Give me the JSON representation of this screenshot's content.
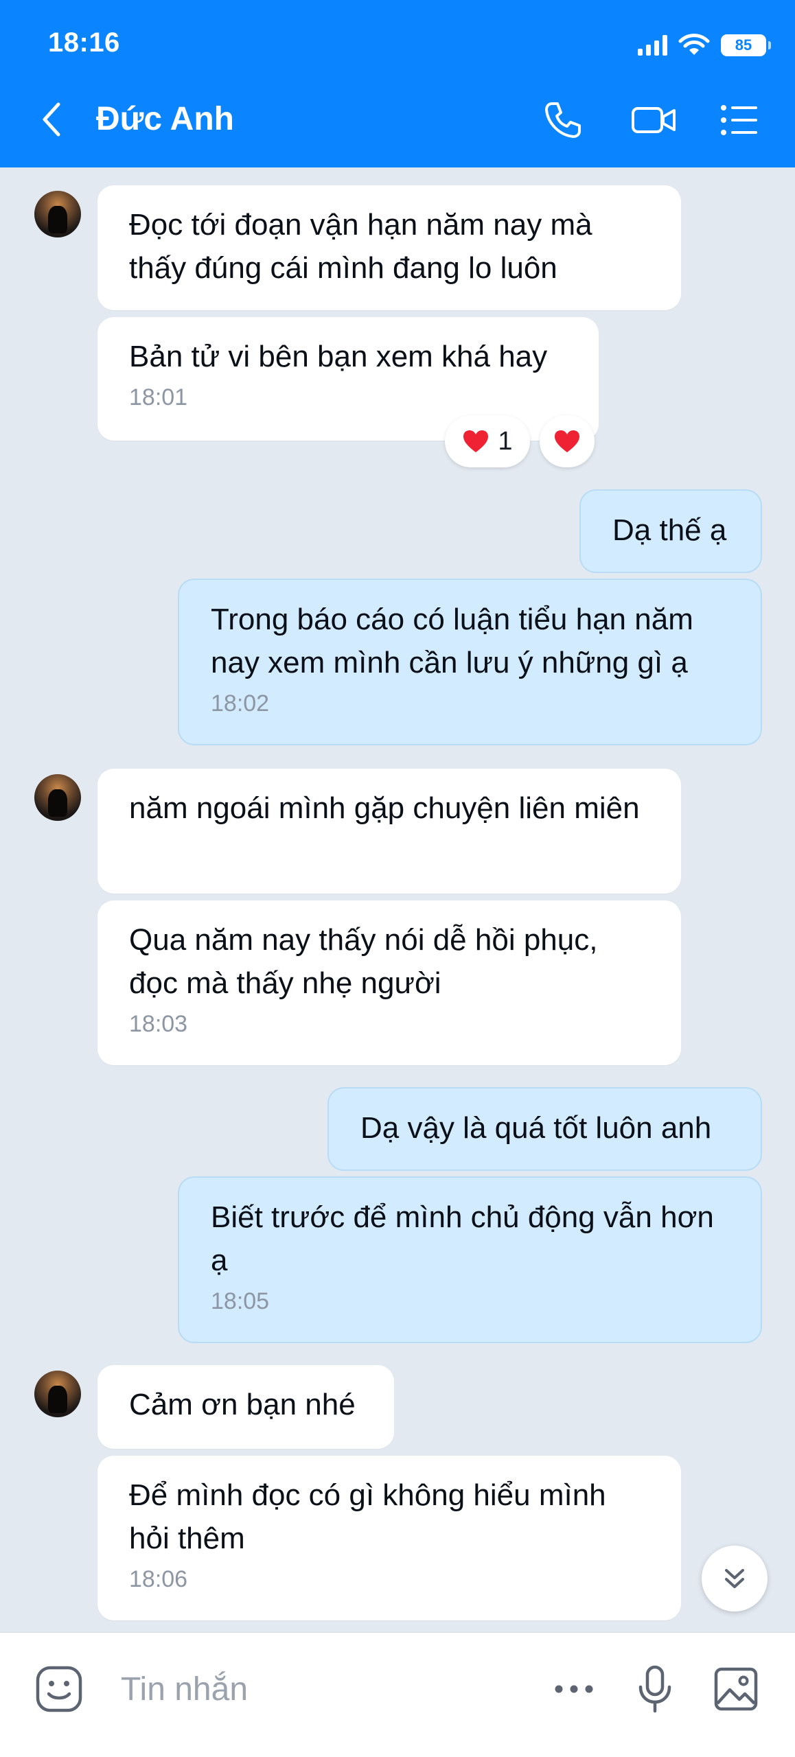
{
  "status_bar": {
    "time": "18:16",
    "battery": "85"
  },
  "header": {
    "contact_name": "Đức Anh"
  },
  "messages": [
    {
      "text": "Đọc tới đoạn vận hạn năm nay mà thấy đúng cái mình đang lo luôn"
    },
    {
      "text": "Bản tử vi bên bạn xem khá hay",
      "time": "18:01"
    },
    {
      "text": "Dạ thế ạ"
    },
    {
      "text": "Trong báo cáo có luận tiểu hạn năm nay xem mình cần lưu ý những gì ạ",
      "time": "18:02"
    },
    {
      "text": "năm ngoái mình gặp chuyện liên miên"
    },
    {
      "text": "Qua năm nay thấy nói dễ hồi phục, đọc mà thấy nhẹ người",
      "time": "18:03"
    },
    {
      "text": "Dạ vậy là quá tốt luôn anh"
    },
    {
      "text": "Biết trước để mình chủ động vẫn hơn ạ",
      "time": "18:05"
    },
    {
      "text": "Cảm ơn bạn nhé"
    },
    {
      "text": "Để mình đọc có gì không hiểu mình hỏi thêm",
      "time": "18:06"
    }
  ],
  "reactions": {
    "heart_count": "1"
  },
  "composer": {
    "placeholder": "Tin nhắn"
  },
  "colors": {
    "accent": "#0a84ff",
    "outgoing_bubble": "#d2ebff",
    "incoming_bubble": "#ffffff",
    "heart": "#ee2233"
  },
  "icons": [
    "back-icon",
    "phone-icon",
    "video-call-icon",
    "menu-list-icon",
    "heart-icon",
    "scroll-down-icon",
    "sticker-icon",
    "more-icon",
    "microphone-icon",
    "image-icon"
  ]
}
